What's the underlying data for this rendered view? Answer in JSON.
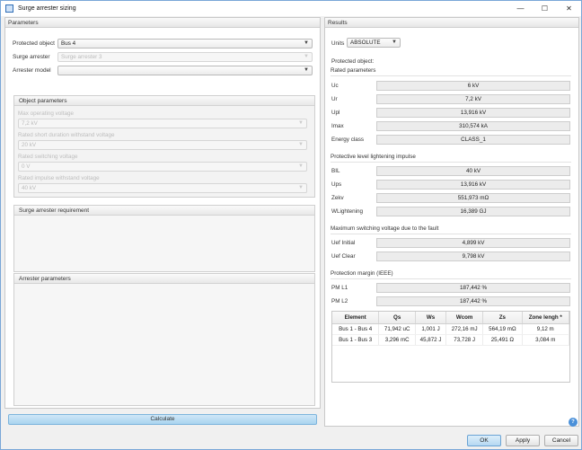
{
  "window": {
    "title": "Surge arrester sizing",
    "controls": [
      "—",
      "☐",
      "✕"
    ]
  },
  "parameters": {
    "header": "Parameters",
    "protected_object_label": "Protected object",
    "protected_object_value": "Bus 4",
    "surge_arrester_label": "Surge arrester",
    "surge_arrester_value": "Surge arrester 3",
    "arrester_model_label": "Arrester model",
    "arrester_model_value": "",
    "object_parameters": {
      "header": "Object parameters",
      "fields": [
        {
          "label": "Max operating voltage",
          "value": "7,2 kV"
        },
        {
          "label": "Rated short duration withstand voltage",
          "value": "20 kV"
        },
        {
          "label": "Rated switching voltage",
          "value": "0 V"
        },
        {
          "label": "Rated impulse withstand voltage",
          "value": "40 kV"
        }
      ]
    },
    "requirement_header": "Surge arrester requirement",
    "arrester_params_header": "Arrester parameters",
    "calculate_label": "Calculate"
  },
  "results": {
    "header": "Results",
    "units_label": "Units",
    "units_value": "ABSOLUTE",
    "protected_object_label": "Protected object:",
    "rated_parameters_label": "Rated parameters",
    "rated": [
      {
        "label": "Uc",
        "value": "6 kV"
      },
      {
        "label": "Ur",
        "value": "7,2 kV"
      },
      {
        "label": "Upl",
        "value": "13,916 kV"
      },
      {
        "label": "Imax",
        "value": "310,574 kA"
      },
      {
        "label": "Energy class",
        "value": "CLASS_1"
      }
    ],
    "lightning_header": "Protective level lightening impulse",
    "lightning": [
      {
        "label": "BIL",
        "value": "40 kV"
      },
      {
        "label": "Ups",
        "value": "13,916 kV"
      },
      {
        "label": "Zekv",
        "value": "551,973 mΩ"
      },
      {
        "label": "WLightening",
        "value": "16,389 GJ"
      }
    ],
    "switching_header": "Maximum switching voltage due to the fault",
    "switching": [
      {
        "label": "Uef Initial",
        "value": "4,899 kV"
      },
      {
        "label": "Uef Clear",
        "value": "9,798 kV"
      }
    ],
    "margin_header": "Protection margin (IEEE)",
    "margin": [
      {
        "label": "PM L1",
        "value": "187,442 %"
      },
      {
        "label": "PM L2",
        "value": "187,442 %"
      }
    ],
    "table": {
      "columns": [
        "Element",
        "Qs",
        "Ws",
        "Wcom",
        "Zs",
        "Zone lengh *"
      ],
      "rows": [
        [
          "Bus 1 - Bus 4",
          "71,942 uC",
          "1,001 J",
          "272,16 mJ",
          "564,19 mΩ",
          "9,12 m"
        ],
        [
          "Bus 1 - Bus 3",
          "3,296 mC",
          "45,872 J",
          "73,728 J",
          "25,491 Ω",
          "3,084 m"
        ]
      ]
    }
  },
  "footer": {
    "ok_label": "OK",
    "apply_label": "Apply",
    "cancel_label": "Cancel"
  },
  "colors": {
    "accent": "#4a90d9",
    "calculate_bg": "#b9dcf2"
  }
}
